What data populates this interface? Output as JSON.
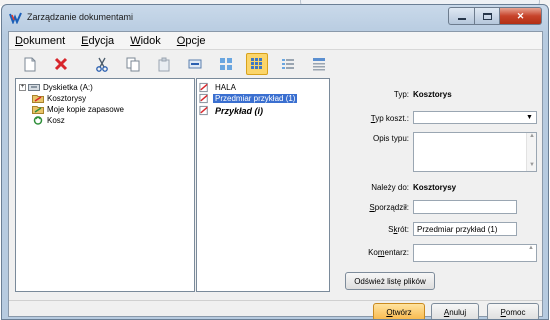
{
  "window": {
    "title": "Zarządzanie dokumentami"
  },
  "menu": [
    {
      "label": "Dokument",
      "mnemonic": "D",
      "rest": "okument"
    },
    {
      "label": "Edycja",
      "mnemonic": "E",
      "rest": "dycja"
    },
    {
      "label": "Widok",
      "mnemonic": "W",
      "rest": "idok"
    },
    {
      "label": "Opcje",
      "mnemonic": "O",
      "rest": "pcje"
    }
  ],
  "toolbar": {
    "buttons": [
      "new-doc-icon",
      "delete-icon",
      "cut-icon",
      "copy-icon",
      "paste-icon",
      "rename-icon",
      "large-icons-view-icon",
      "small-icons-view-icon",
      "list-view-icon",
      "details-view-icon"
    ],
    "active": "small-icons-view-icon"
  },
  "tree": {
    "items": [
      {
        "label": "Dyskietka (A:)",
        "expander": "+"
      },
      {
        "label": "Kosztorysy"
      },
      {
        "label": "Moje kopie zapasowe"
      },
      {
        "label": "Kosz"
      }
    ]
  },
  "files": {
    "items": [
      {
        "label": "HALA"
      },
      {
        "label": "Przedmiar przykład (1)"
      },
      {
        "label": "Przykład (i)"
      }
    ],
    "selected_index": 1
  },
  "props": {
    "typ_label": "Typ:",
    "typ_value": "Kosztorys",
    "typ_kosztu_label_u": "T",
    "typ_kosztu_label_rest": "yp koszt.:",
    "typ_kosztu_value": "",
    "opis_label": "Opis typu:",
    "opis_value": "",
    "nalezy_label": "Należy do:",
    "nalezy_value": "Kosztorysy",
    "sporzadzil_label_u": "S",
    "sporzadzil_label_rest": "porządził:",
    "sporzadzil_value": "",
    "skrot_label_pre": "S",
    "skrot_label_u": "k",
    "skrot_label_rest": "rót:",
    "skrot_value": "Przedmiar przykład (1)",
    "komentarz_label_pre": "Ko",
    "komentarz_label_u": "m",
    "komentarz_label_rest": "entarz:",
    "komentarz_value": ""
  },
  "buttons": {
    "refresh": "Odśwież listę plików",
    "open_u": "O",
    "open_rest": "twórz",
    "cancel_u": "A",
    "cancel_rest": "nuluj",
    "help_u": "P",
    "help_rest": "omoc"
  },
  "colors": {
    "selection": "#3a6fd0",
    "default_button": "#f8b84b",
    "close_button": "#c7432a"
  }
}
